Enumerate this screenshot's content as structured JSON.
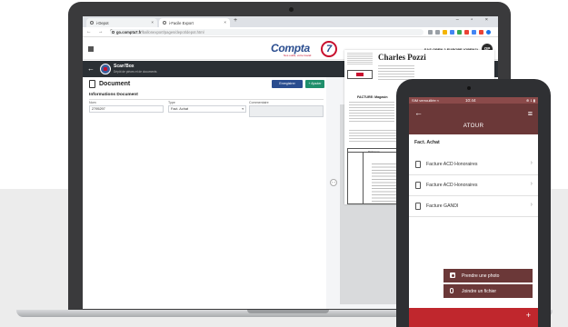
{
  "browser": {
    "tabs": [
      {
        "label": "i-Depot",
        "close": "×"
      },
      {
        "label": "i-Facile Export",
        "close": "×"
      }
    ],
    "new_tab": "+",
    "window_controls": "– ▫ ×",
    "nav": "← → C",
    "url_host": "go.compta7.fr",
    "url_path": "/ballonexport/pages/depot/depot.html"
  },
  "app": {
    "logo_text": "Compta",
    "logo_number": "7",
    "logo_tagline": "Nos outils, votre travail",
    "company": "SAS OPEN 2 EUROPE (OPEN2)",
    "avatar": "OP",
    "bar": {
      "back": "←",
      "title": "Scan'Box",
      "subtitle": "Dépôt de pièces et de documents",
      "action_scan": "Envoi multiple",
      "action_new": "+ Nouveau document",
      "help": "?"
    }
  },
  "document": {
    "title": "Document",
    "save_label": "Enregistrer",
    "add_label": "+ Ajouter",
    "section_title": "Informations Document",
    "fields": {
      "nom_label": "Nom",
      "nom_value": "2795297",
      "type_label": "Type",
      "type_value": "Fact. Achat",
      "type_caret": "▾",
      "commentaire_label": "Commentaire",
      "commentaire_value": ""
    }
  },
  "preview": {
    "nav": "‹ ›",
    "company": "Charles Pozzi",
    "invoice_title": "FACTURE: Magasin",
    "table_header": "Référence"
  },
  "phone": {
    "carrier": "SIM verrouillée ≈",
    "time": "10:44",
    "battery": "⊕ 1 ▮ ",
    "back": "←",
    "menu": "≡",
    "title": "ATOUR",
    "section": "Fact. Achat",
    "items": [
      {
        "label": "Facture ACD Honoraires",
        "chevron": "›"
      },
      {
        "label": "Facture ACD Honoraires",
        "chevron": "›"
      },
      {
        "label": "Facture GANDI",
        "chevron": "›"
      }
    ],
    "actions": {
      "photo": "Prendre une photo",
      "file": "Joindre un fichier"
    },
    "fab": "+"
  }
}
